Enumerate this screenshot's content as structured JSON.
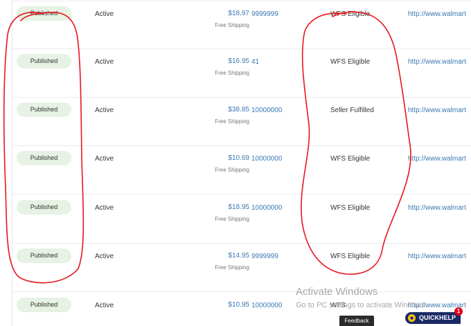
{
  "rows": [
    {
      "status_badge": "Published",
      "lifecycle": "Active",
      "price": "$18.97",
      "shipping": "Free Shipping",
      "quantity": "9999999",
      "fulfillment": "WFS Eligible",
      "url": "http://www.walmart"
    },
    {
      "status_badge": "Published",
      "lifecycle": "Active",
      "price": "$16.95",
      "shipping": "Free Shipping",
      "quantity": "41",
      "fulfillment": "WFS Eligible",
      "url": "http://www.walmart"
    },
    {
      "status_badge": "Published",
      "lifecycle": "Active",
      "price": "$38.85",
      "shipping": "Free Shipping",
      "quantity": "10000000",
      "fulfillment": "Seller Fulfilled",
      "url": "http://www.walmart"
    },
    {
      "status_badge": "Published",
      "lifecycle": "Active",
      "price": "$10.69",
      "shipping": "Free Shipping",
      "quantity": "10000000",
      "fulfillment": "WFS Eligible",
      "url": "http://www.walmart"
    },
    {
      "status_badge": "Published",
      "lifecycle": "Active",
      "price": "$18.95",
      "shipping": "Free Shipping",
      "quantity": "10000000",
      "fulfillment": "WFS Eligible",
      "url": "http://www.walmart"
    },
    {
      "status_badge": "Published",
      "lifecycle": "Active",
      "price": "$14.95",
      "shipping": "Free Shipping",
      "quantity": "9999999",
      "fulfillment": "WFS Eligible",
      "url": "http://www.walmart"
    },
    {
      "status_badge": "Published",
      "lifecycle": "Active",
      "price": "$10.95",
      "shipping": "",
      "quantity": "10000000",
      "fulfillment": "WFS",
      "url": "http://www.walmart"
    }
  ],
  "watermark": {
    "title": "Activate Windows",
    "subtitle": "Go to PC settings to activate Windows."
  },
  "feedback_label": "Feedback",
  "quickhelp": {
    "label": "QUICKHELP",
    "count": "1"
  },
  "colors": {
    "badge_bg": "#e6f2e3",
    "link": "#3c78b4",
    "annotation": "#e8141b",
    "quickhelp_bg": "#1a2a66"
  }
}
